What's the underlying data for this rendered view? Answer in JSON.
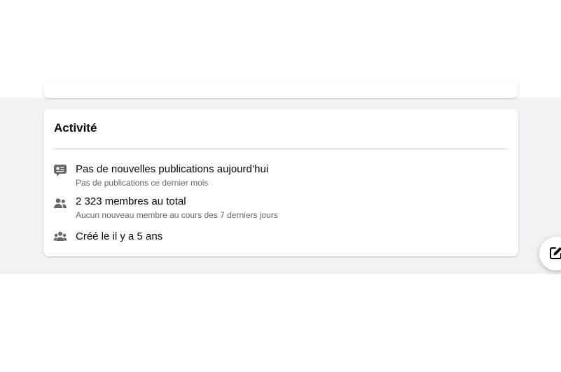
{
  "activity": {
    "title": "Activité",
    "items": [
      {
        "icon": "chat-posts-icon",
        "primary": "Pas de nouvelles publications aujourd’hui",
        "secondary": "Pas de publications ce dernier mois"
      },
      {
        "icon": "members-icon",
        "primary": "2 323 membres au total",
        "secondary": "Aucun nouveau membre au cours des 7 derniers jours"
      },
      {
        "icon": "group-icon",
        "primary": "Créé le il y a 5 ans"
      }
    ]
  },
  "compose": {
    "icon": "edit-icon"
  }
}
